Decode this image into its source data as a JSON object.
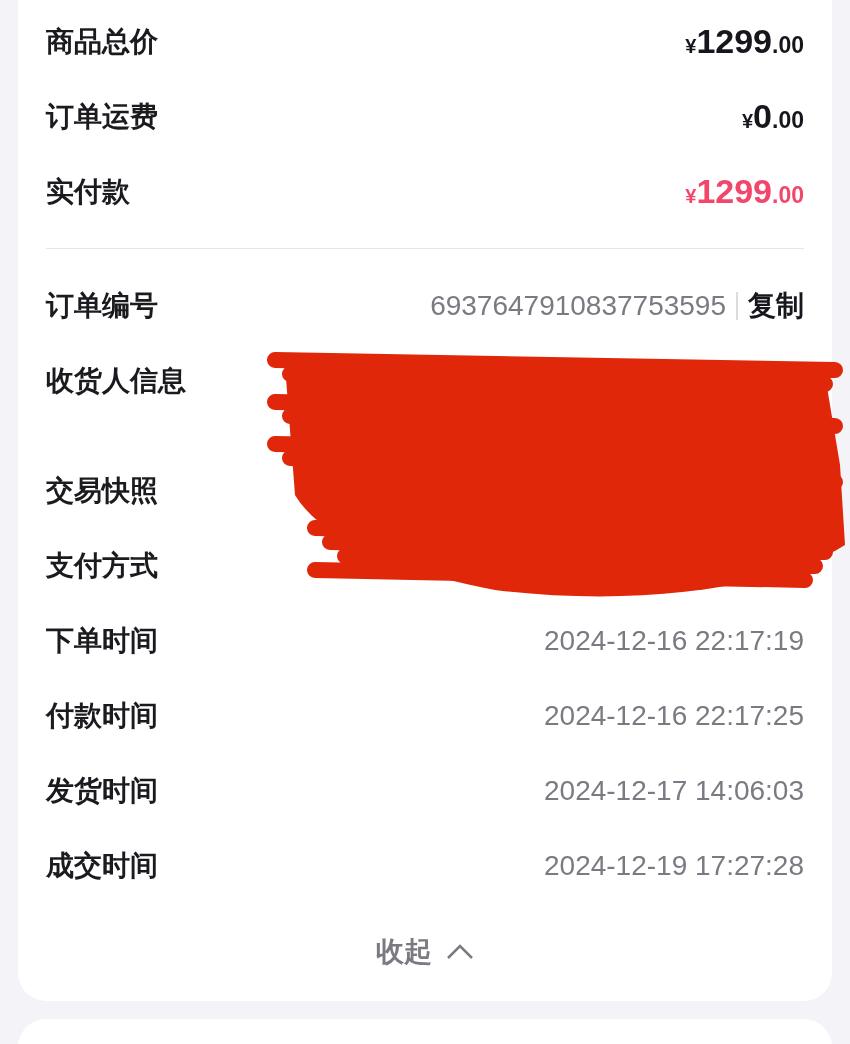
{
  "amounts": [
    {
      "label": "商品总价",
      "currency": "¥",
      "integer": "1299",
      "decimal": ".00",
      "highlight": false
    },
    {
      "label": "订单运费",
      "currency": "¥",
      "integer": "0",
      "decimal": ".00",
      "highlight": false
    },
    {
      "label": "实付款",
      "currency": "¥",
      "integer": "1299",
      "decimal": ".00",
      "highlight": true
    }
  ],
  "details": [
    {
      "kind": "order_no",
      "label": "订单编号",
      "value": "6937647910837753595",
      "action": "复制"
    },
    {
      "kind": "multiline",
      "label": "收货人信息"
    },
    {
      "kind": "redacted",
      "label": "交易快照"
    },
    {
      "kind": "redacted",
      "label": "支付方式"
    },
    {
      "kind": "time",
      "label": "下单时间",
      "value": "2024-12-16 22:17:19"
    },
    {
      "kind": "time",
      "label": "付款时间",
      "value": "2024-12-16 22:17:25"
    },
    {
      "kind": "time",
      "label": "发货时间",
      "value": "2024-12-17 14:06:03"
    },
    {
      "kind": "time",
      "label": "成交时间",
      "value": "2024-12-19 17:27:28"
    }
  ],
  "collapse": {
    "label": "收起"
  },
  "redacted": true
}
